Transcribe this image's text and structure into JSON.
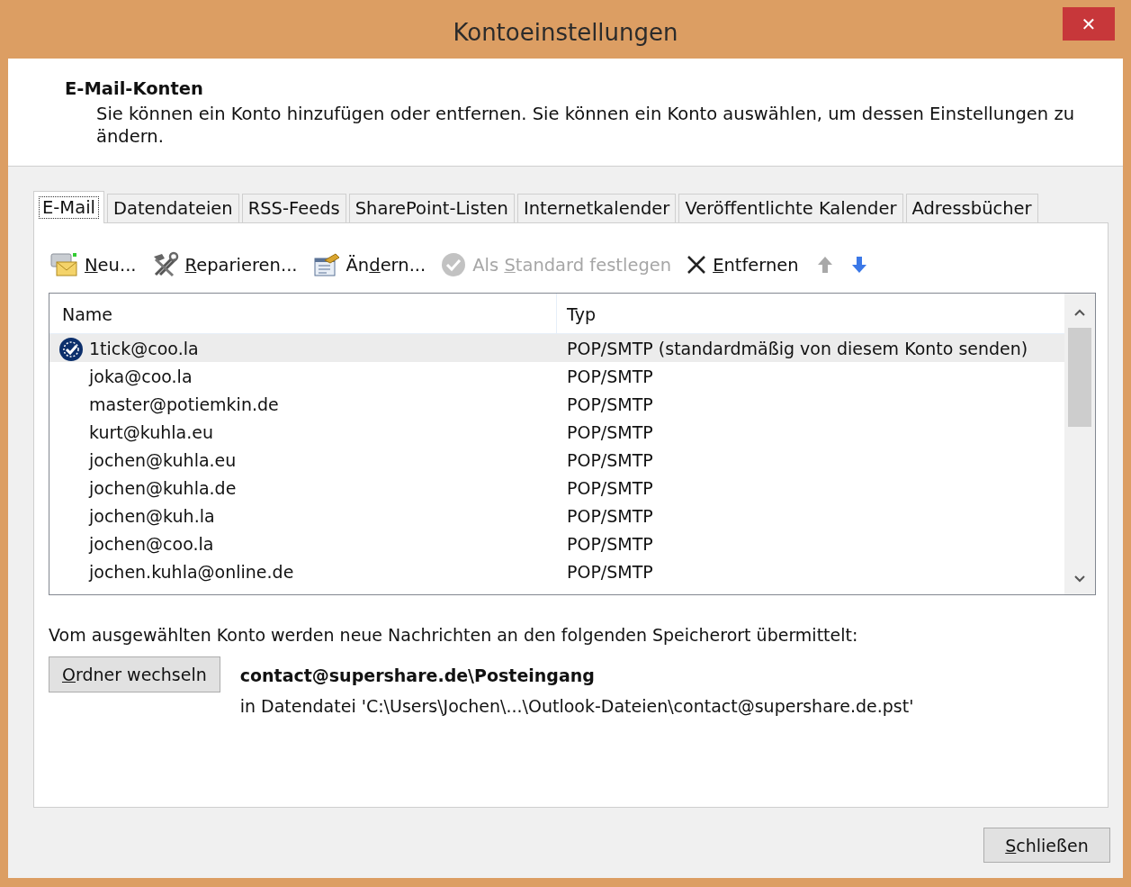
{
  "window": {
    "title": "Kontoeinstellungen",
    "close": "✕"
  },
  "header": {
    "title": "E-Mail-Konten",
    "description": "Sie können ein Konto hinzufügen oder entfernen. Sie können ein Konto auswählen, um dessen Einstellungen zu ändern."
  },
  "tabs": [
    {
      "label": "E-Mail",
      "selected": true
    },
    {
      "label": "Datendateien",
      "selected": false
    },
    {
      "label": "RSS-Feeds",
      "selected": false
    },
    {
      "label": "SharePoint-Listen",
      "selected": false
    },
    {
      "label": "Internetkalender",
      "selected": false
    },
    {
      "label": "Veröffentlichte Kalender",
      "selected": false
    },
    {
      "label": "Adressbücher",
      "selected": false
    }
  ],
  "toolbar": [
    {
      "kind": "new",
      "label": {
        "key": "N",
        "post": "eu..."
      },
      "disabled": false
    },
    {
      "kind": "repair",
      "label": {
        "key": "R",
        "post": "eparieren..."
      },
      "disabled": false
    },
    {
      "kind": "change",
      "label": {
        "pre": "Än",
        "key": "d",
        "post": "ern..."
      },
      "disabled": false
    },
    {
      "kind": "default",
      "label": {
        "pre": "Als ",
        "key": "S",
        "post": "tandard festlegen"
      },
      "disabled": true
    },
    {
      "kind": "remove",
      "label": {
        "key": "E",
        "post": "ntfernen"
      },
      "disabled": false
    },
    {
      "kind": "up",
      "disabled": true
    },
    {
      "kind": "down",
      "disabled": false
    }
  ],
  "table": {
    "columns": [
      "Name",
      "Typ"
    ],
    "rows": [
      {
        "name": "1tick@coo.la",
        "type": "POP/SMTP (standardmäßig von diesem Konto senden)",
        "default": true,
        "selected": true
      },
      {
        "name": "joka@coo.la",
        "type": "POP/SMTP",
        "default": false,
        "selected": false
      },
      {
        "name": "master@potiemkin.de",
        "type": "POP/SMTP",
        "default": false,
        "selected": false
      },
      {
        "name": "kurt@kuhla.eu",
        "type": "POP/SMTP",
        "default": false,
        "selected": false
      },
      {
        "name": "jochen@kuhla.eu",
        "type": "POP/SMTP",
        "default": false,
        "selected": false
      },
      {
        "name": "jochen@kuhla.de",
        "type": "POP/SMTP",
        "default": false,
        "selected": false
      },
      {
        "name": "jochen@kuh.la",
        "type": "POP/SMTP",
        "default": false,
        "selected": false
      },
      {
        "name": "jochen@coo.la",
        "type": "POP/SMTP",
        "default": false,
        "selected": false
      },
      {
        "name": "jochen.kuhla@online.de",
        "type": "POP/SMTP",
        "default": false,
        "selected": false
      }
    ]
  },
  "delivery": {
    "text": "Vom ausgewählten Konto werden neue Nachrichten an den folgenden Speicherort übermittelt:",
    "button": {
      "key": "O",
      "post": "rdner wechseln"
    },
    "folder": "contact@supershare.de\\Posteingang",
    "file": "in Datendatei 'C:\\Users\\Jochen\\...\\Outlook-Dateien\\contact@supershare.de.pst'"
  },
  "footer": {
    "close_button": {
      "key": "S",
      "post": "chließen"
    }
  }
}
